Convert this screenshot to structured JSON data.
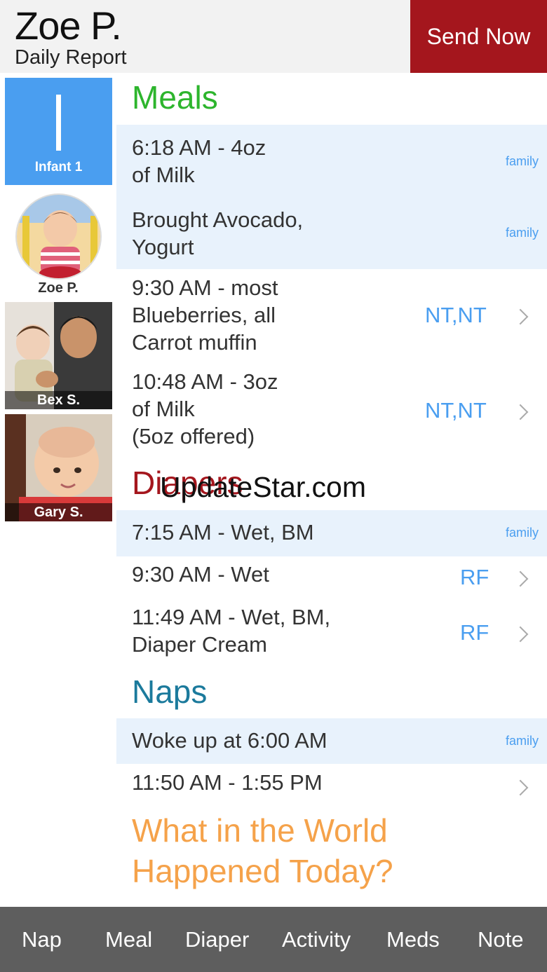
{
  "header": {
    "child_name": "Zoe P.",
    "subtitle": "Daily Report",
    "send_label": "Send Now"
  },
  "sidebar": {
    "room": {
      "numeral": "I",
      "label": "Infant 1"
    },
    "selected_child": "Zoe P.",
    "children": [
      {
        "name": "Bex S."
      },
      {
        "name": "Gary S."
      }
    ]
  },
  "meals": {
    "title": "Meals",
    "entries": [
      {
        "text_line1": "6:18 AM - 4oz",
        "text_line2": "of Milk",
        "tag": "family"
      },
      {
        "text_line1": "Brought Avocado,",
        "text_line2": "Yogurt",
        "tag": "family"
      },
      {
        "text_line1": "9:30 AM - most",
        "text_line2": "Blueberries, all",
        "text_line3": "Carrot muffin",
        "initials": "NT,NT"
      },
      {
        "text_line1": "10:48 AM - 3oz",
        "text_line2": "of Milk",
        "text_line3": "(5oz offered)",
        "initials": "NT,NT"
      }
    ]
  },
  "diapers": {
    "title": "Diapers",
    "entries": [
      {
        "text_line1": "7:15 AM - Wet, BM",
        "tag": "family"
      },
      {
        "text_line1": "9:30 AM - Wet",
        "initials": "RF"
      },
      {
        "text_line1": "11:49 AM - Wet, BM,",
        "text_line2": "Diaper Cream",
        "initials": "RF"
      }
    ]
  },
  "naps": {
    "title": "Naps",
    "entries": [
      {
        "text_line1": "Woke up at 6:00 AM",
        "tag": "family"
      },
      {
        "text_line1": "11:50 AM - 1:55 PM"
      }
    ]
  },
  "prompt": {
    "line1": "What in the World",
    "line2": "Happened Today?"
  },
  "watermark": "UpdateStar.com",
  "toolbar": {
    "items": [
      "Nap",
      "Meal",
      "Diaper",
      "Activity",
      "Meds",
      "Note"
    ]
  },
  "colors": {
    "send_button": "#a4161d",
    "meals_title": "#2db52d",
    "diapers_title": "#a4161d",
    "naps_title": "#1b7a9c",
    "prompt": "#f5a24a",
    "accent_blue": "#4a9ef0",
    "row_shade": "#e8f2fc",
    "toolbar": "#5e5e5e"
  }
}
